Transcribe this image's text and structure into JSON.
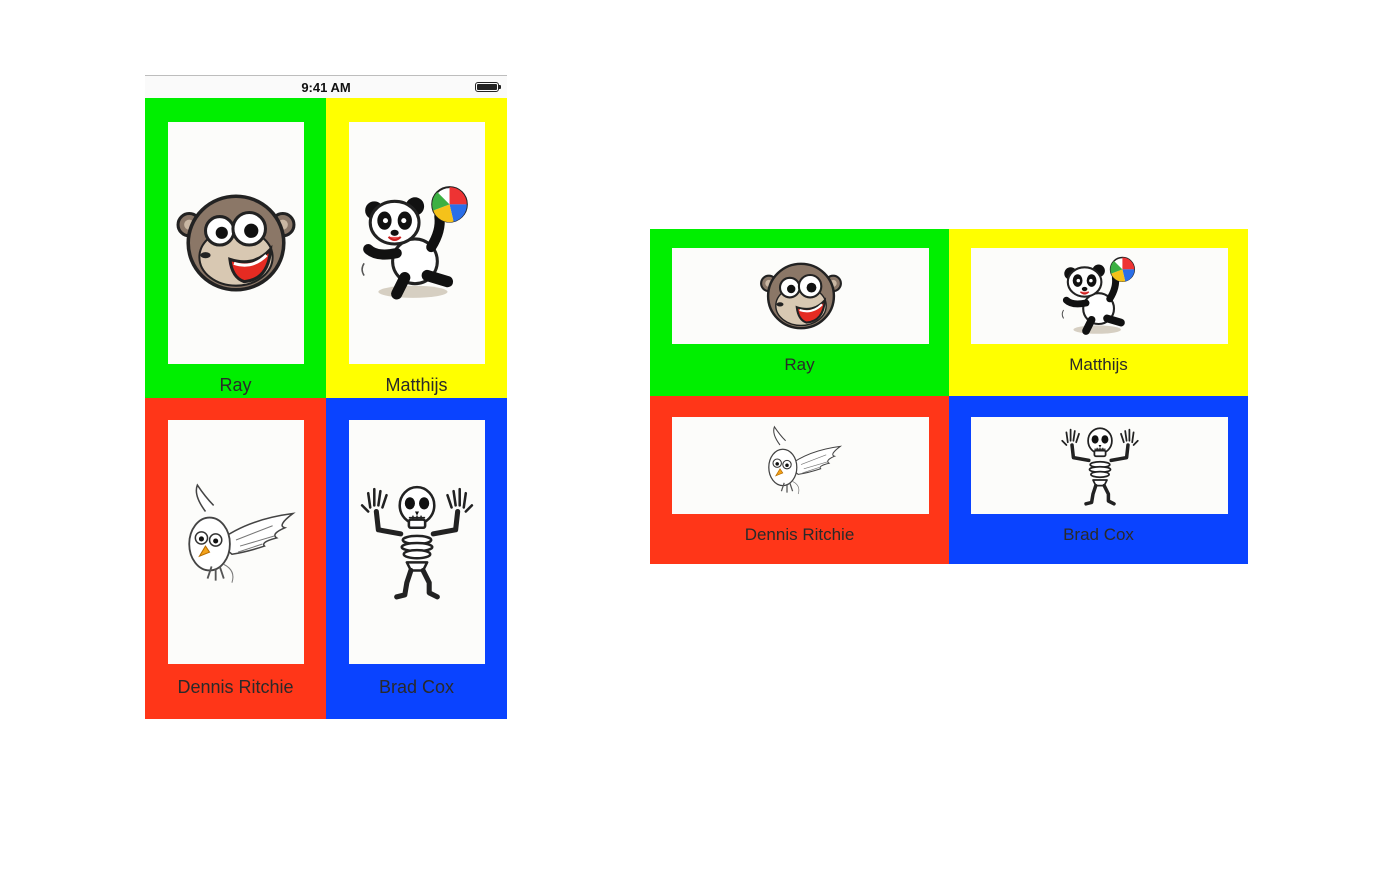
{
  "status_bar": {
    "time": "9:41 AM"
  },
  "people": [
    {
      "name": "Ray",
      "bg": "#00ef00",
      "icon": "monkey-icon"
    },
    {
      "name": "Matthijs",
      "bg": "#ffff00",
      "icon": "panda-icon"
    },
    {
      "name": "Dennis Ritchie",
      "bg": "#ff3618",
      "icon": "owl-icon"
    },
    {
      "name": "Brad Cox",
      "bg": "#0a43ff",
      "icon": "skeleton-icon"
    }
  ]
}
